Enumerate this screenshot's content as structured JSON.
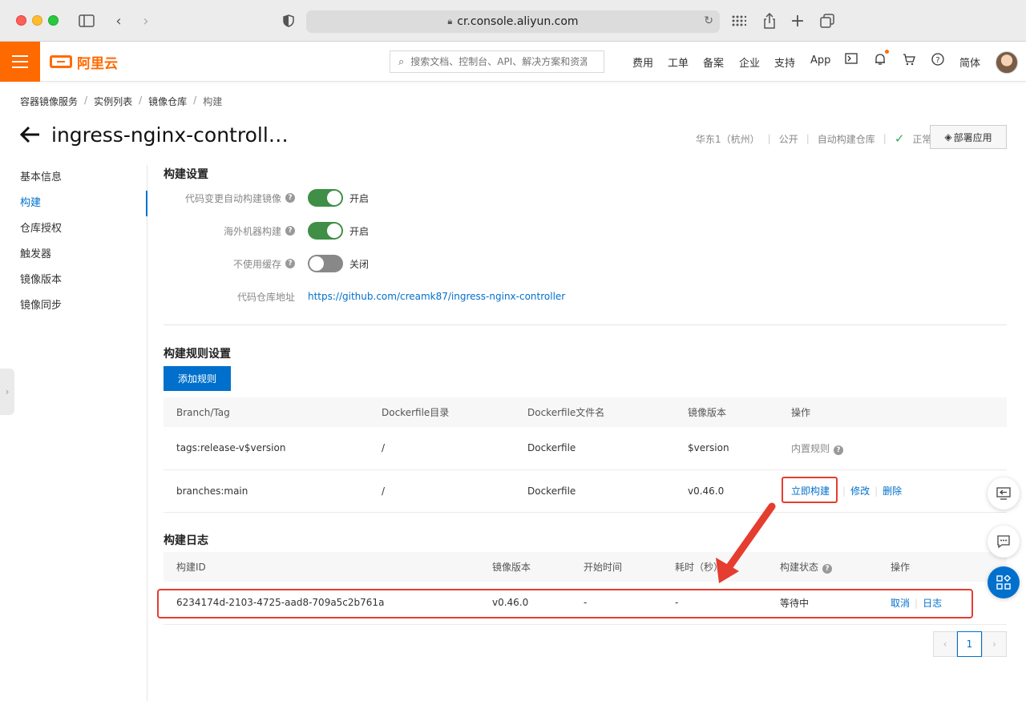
{
  "browser": {
    "url": "cr.console.aliyun.com"
  },
  "topnav": {
    "logo_text": "阿里云",
    "search_placeholder": "搜索文档、控制台、API、解决方案和资源",
    "items": [
      "费用",
      "工单",
      "备案",
      "企业",
      "支持",
      "App"
    ],
    "lang": "简体"
  },
  "breadcrumb": [
    "容器镜像服务",
    "实例列表",
    "镜像仓库",
    "构建"
  ],
  "header": {
    "title": "ingress-nginx-controll…",
    "region": "华东1（杭州）",
    "visibility": "公开",
    "repo_type": "自动构建仓库",
    "status": "正常",
    "deploy_button": "部署应用"
  },
  "sidenav": [
    "基本信息",
    "构建",
    "仓库授权",
    "触发器",
    "镜像版本",
    "镜像同步"
  ],
  "build_settings": {
    "title": "构建设置",
    "auto_build_label": "代码变更自动构建镜像",
    "auto_build_state": "开启",
    "overseas_label": "海外机器构建",
    "overseas_state": "开启",
    "no_cache_label": "不使用缓存",
    "no_cache_state": "关闭",
    "repo_url_label": "代码仓库地址",
    "repo_url": "https://github.com/creamk87/ingress-nginx-controller"
  },
  "rules": {
    "title": "构建规则设置",
    "add_button": "添加规则",
    "columns": [
      "Branch/Tag",
      "Dockerfile目录",
      "Dockerfile文件名",
      "镜像版本",
      "操作"
    ],
    "rows": [
      {
        "branch": "tags:release-v$version",
        "dir": "/",
        "file": "Dockerfile",
        "version": "$version",
        "action": "内置规则"
      },
      {
        "branch": "branches:main",
        "dir": "/",
        "file": "Dockerfile",
        "version": "v0.46.0",
        "build_now": "立即构建",
        "edit": "修改",
        "delete": "删除"
      }
    ]
  },
  "logs": {
    "title": "构建日志",
    "columns": [
      "构建ID",
      "镜像版本",
      "开始时间",
      "耗时（秒）",
      "构建状态",
      "操作"
    ],
    "rows": [
      {
        "id": "6234174d-2103-4725-aad8-709a5c2b761a",
        "version": "v0.46.0",
        "start": "-",
        "duration": "-",
        "status": "等待中",
        "cancel": "取消",
        "log": "日志"
      }
    ]
  },
  "pagination": {
    "current": "1"
  },
  "colors": {
    "accent": "#ff6a00",
    "link": "#0070cc",
    "toggle_on": "#3f8f46",
    "highlight": "#e53d2f"
  }
}
